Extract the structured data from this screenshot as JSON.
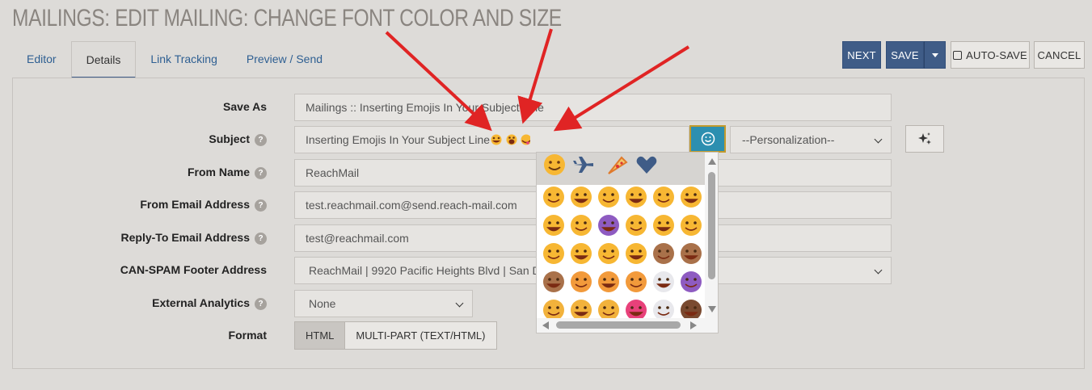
{
  "page_title": "MAILINGS: EDIT MAILING: CHANGE FONT COLOR AND SIZE",
  "tabs": [
    {
      "label": "Editor",
      "active": false
    },
    {
      "label": "Details",
      "active": true
    },
    {
      "label": "Link Tracking",
      "active": false
    },
    {
      "label": "Preview / Send",
      "active": false
    }
  ],
  "toolbar": {
    "next_label": "NEXT",
    "save_label": "SAVE",
    "autosave_label": "AUTO-SAVE",
    "cancel_label": "CANCEL"
  },
  "form": {
    "save_as_label": "Save As",
    "save_as_value": "Mailings :: Inserting Emojis In Your Subject Line",
    "subject_label": "Subject",
    "subject_value": "Inserting Emojis In Your Subject Line",
    "personalization_value": "--Personalization--",
    "from_name_label": "From Name",
    "from_name_value": "ReachMail",
    "from_email_label": "From Email Address",
    "from_email_value": "test.reachmail.com@send.reach-mail.com",
    "reply_to_label": "Reply-To Email Address",
    "reply_to_value": "test@reachmail.com",
    "canspam_label": "CAN-SPAM Footer Address",
    "canspam_value": "ReachMail | 9920 Pacific Heights Blvd | San Diego",
    "analytics_label": "External Analytics",
    "analytics_value": "None",
    "format_label": "Format",
    "format_html": "HTML",
    "format_multipart": "MULTI-PART (TEXT/HTML)"
  },
  "emoji_picker": {
    "category_icons": [
      "smiley-face-icon",
      "airplane-icon",
      "pizza-icon",
      "heart-icon"
    ],
    "emoji_rows": [
      [
        "#f7b733",
        "#f7b733",
        "#f7b733",
        "#f7b733",
        "#f7b733",
        "#f7b733"
      ],
      [
        "#f7b733",
        "#f7b733",
        "#8e5bc1",
        "#f7b733",
        "#f7b733",
        "#f7b733"
      ],
      [
        "#f7b733",
        "#f7b733",
        "#f7b733",
        "#f7b733",
        "#a9714a",
        "#a9714a"
      ],
      [
        "#a9714a",
        "#f29a3b",
        "#f29a3b",
        "#f29a3b",
        "#e8e8ec",
        "#8e5bc1"
      ],
      [
        "#f2b23c",
        "#f2b23c",
        "#f2b23c",
        "#e8417a",
        "#e8e8ec",
        "#7a4a30"
      ]
    ]
  },
  "colors": {
    "primary": "#3f5c87",
    "emoji_button": "#2c8fb0",
    "annotation_arrow": "#e02424"
  }
}
